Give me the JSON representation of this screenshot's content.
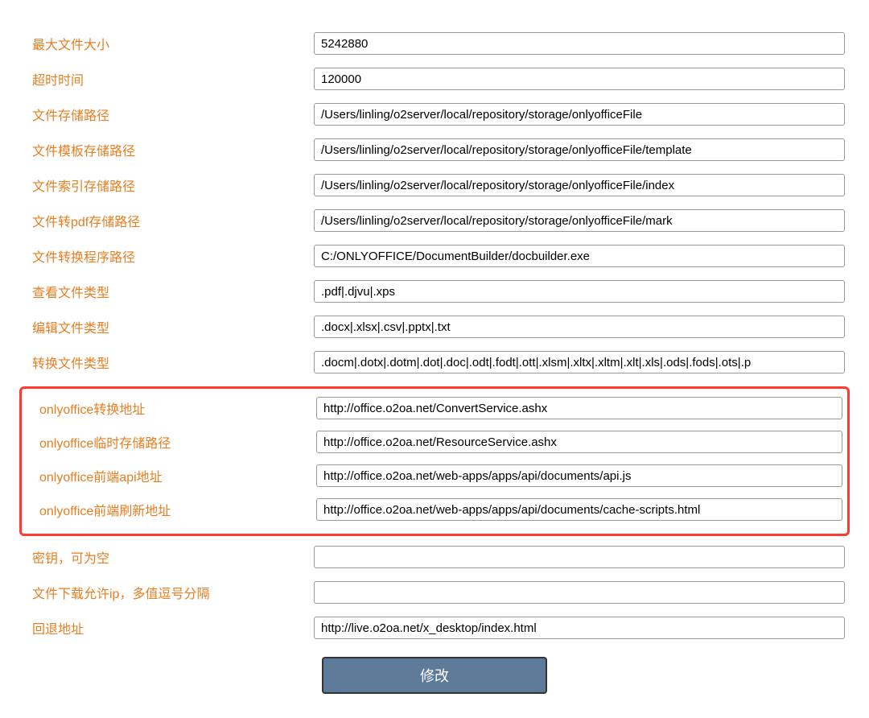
{
  "fields": {
    "maxFileSize": {
      "label": "最大文件大小",
      "value": "5242880"
    },
    "timeout": {
      "label": "超时时间",
      "value": "120000"
    },
    "fileStoragePath": {
      "label": "文件存储路径",
      "value": "/Users/linling/o2server/local/repository/storage/onlyofficeFile"
    },
    "fileTemplatePath": {
      "label": "文件模板存储路径",
      "value": "/Users/linling/o2server/local/repository/storage/onlyofficeFile/template"
    },
    "fileIndexPath": {
      "label": "文件索引存储路径",
      "value": "/Users/linling/o2server/local/repository/storage/onlyofficeFile/index"
    },
    "filePdfPath": {
      "label": "文件转pdf存储路径",
      "value": "/Users/linling/o2server/local/repository/storage/onlyofficeFile/mark"
    },
    "fileConverterPath": {
      "label": "文件转换程序路径",
      "value": "C:/ONLYOFFICE/DocumentBuilder/docbuilder.exe"
    },
    "viewedFileType": {
      "label": "查看文件类型",
      "value": ".pdf|.djvu|.xps"
    },
    "editedFileType": {
      "label": "编辑文件类型",
      "value": ".docx|.xlsx|.csv|.pptx|.txt"
    },
    "convertedFileType": {
      "label": "转换文件类型",
      "value": ".docm|.dotx|.dotm|.dot|.doc|.odt|.fodt|.ott|.xlsm|.xltx|.xltm|.xlt|.xls|.ods|.fods|.ots|.p"
    },
    "onlyofficeConvertUrl": {
      "label": "onlyoffice转换地址",
      "value": "http://office.o2oa.net/ConvertService.ashx"
    },
    "onlyofficeTempPath": {
      "label": "onlyoffice临时存储路径",
      "value": "http://office.o2oa.net/ResourceService.ashx"
    },
    "onlyofficeApiUrl": {
      "label": "onlyoffice前端api地址",
      "value": "http://office.o2oa.net/web-apps/apps/api/documents/api.js"
    },
    "onlyofficeRefreshUrl": {
      "label": "onlyoffice前端刷新地址",
      "value": "http://office.o2oa.net/web-apps/apps/api/documents/cache-scripts.html"
    },
    "secretKey": {
      "label": "密钥，可为空",
      "value": ""
    },
    "allowedIp": {
      "label": "文件下载允许ip，多值逗号分隔",
      "value": ""
    },
    "fallbackUrl": {
      "label": "回退地址",
      "value": "http://live.o2oa.net/x_desktop/index.html"
    }
  },
  "submitLabel": "修改"
}
